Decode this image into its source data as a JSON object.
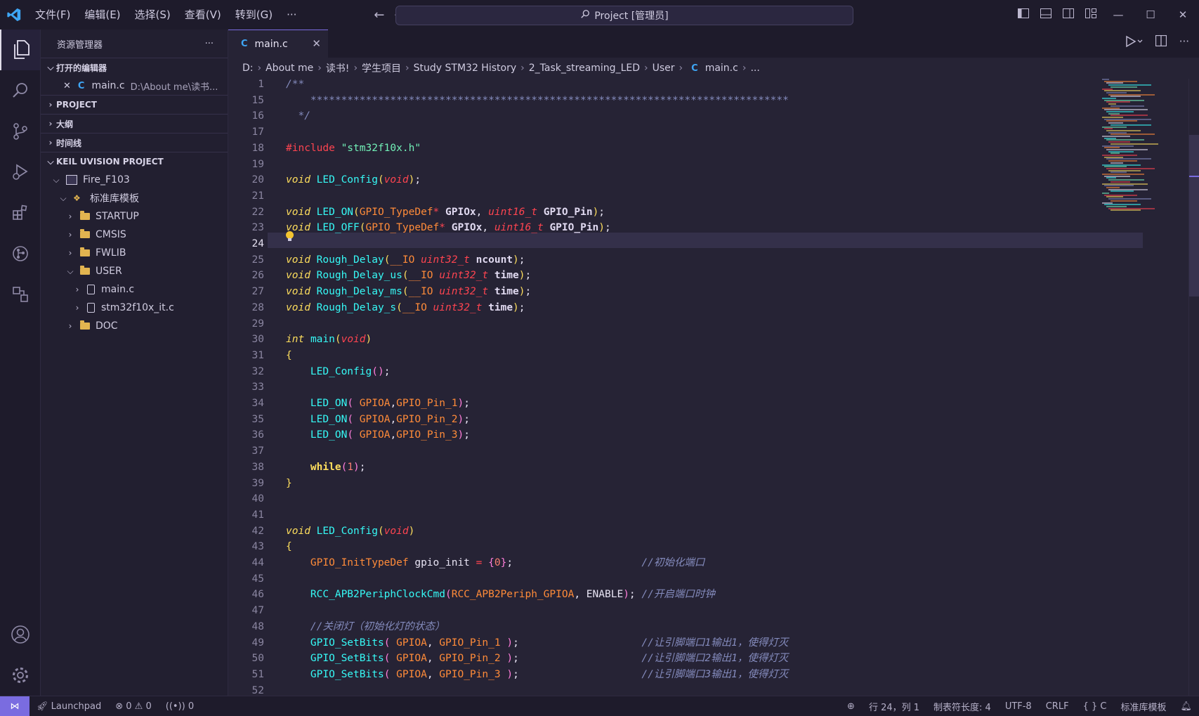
{
  "titlebar": {
    "menus": [
      "文件(F)",
      "编辑(E)",
      "选择(S)",
      "查看(V)",
      "转到(G)",
      "···"
    ],
    "search": "Project [管理员]"
  },
  "sidebar": {
    "title": "资源管理器",
    "more": "···",
    "open_editors_label": "打开的编辑器",
    "open_file_name": "main.c",
    "open_file_path": "D:\\About me\\读书...",
    "sections": [
      "PROJECT",
      "大纲",
      "时间线"
    ],
    "keil_label": "KEIL UVISION PROJECT",
    "tree": {
      "root": "Fire_F103",
      "group": "标准库模板",
      "startup": "STARTUP",
      "cmsis": "CMSIS",
      "fwlib": "FWLIB",
      "user": "USER",
      "main": "main.c",
      "it": "stm32f10x_it.c",
      "doc": "DOC"
    }
  },
  "tab": {
    "icon": "C",
    "label": "main.c"
  },
  "breadcrumb": [
    "D:",
    "About me",
    "读书!",
    "学生项目",
    "Study STM32 History",
    "2_Task_streaming_LED",
    "User",
    "main.c",
    "..."
  ],
  "editor": {
    "current_line": 24,
    "lines": [
      {
        "n": 1,
        "html": "<span class='cm'>/**</span>"
      },
      {
        "n": 15,
        "html": "<span class='cm'>    ******************************************************************************</span>"
      },
      {
        "n": 16,
        "html": "<span class='cm'>  */</span>"
      },
      {
        "n": 17,
        "html": ""
      },
      {
        "n": 18,
        "html": "<span class='pp'>#include</span> <span class='str'>\"stm32f10x.h\"</span>"
      },
      {
        "n": 19,
        "html": ""
      },
      {
        "n": 20,
        "html": "<span class='kw'>void</span> <span class='fn'>LED_Config</span><span class='br2'>(</span><span class='ty'>void</span><span class='br2'>)</span><span class='pu'>;</span>"
      },
      {
        "n": 21,
        "html": ""
      },
      {
        "n": 22,
        "html": "<span class='kw'>void</span> <span class='fn'>LED_ON</span><span class='br2'>(</span><span class='tyu'>GPIO_TypeDef</span><span class='op'>*</span> <span class='pb'>GPIOx</span><span class='pu'>,</span> <span class='ty'>uint16_t</span> <span class='pb'>GPIO_Pin</span><span class='br2'>)</span><span class='pu'>;</span>"
      },
      {
        "n": 23,
        "html": "<span class='kw'>void</span> <span class='fn'>LED_OFF</span><span class='br2'>(</span><span class='tyu'>GPIO_TypeDef</span><span class='op'>*</span> <span class='pb'>GPIOx</span><span class='pu'>,</span> <span class='ty'>uint16_t</span> <span class='pb'>GPIO_Pin</span><span class='br2'>)</span><span class='pu'>;</span>"
      },
      {
        "n": 24,
        "html": ""
      },
      {
        "n": 25,
        "html": "<span class='kw'>void</span> <span class='fn'>Rough_Delay</span><span class='br2'>(</span><span class='mac'>__IO</span> <span class='ty'>uint32_t</span> <span class='pb'>ncount</span><span class='br2'>)</span><span class='pu'>;</span>"
      },
      {
        "n": 26,
        "html": "<span class='kw'>void</span> <span class='fn'>Rough_Delay_us</span><span class='br2'>(</span><span class='mac'>__IO</span> <span class='ty'>uint32_t</span> <span class='pb'>time</span><span class='br2'>)</span><span class='pu'>;</span>"
      },
      {
        "n": 27,
        "html": "<span class='kw'>void</span> <span class='fn'>Rough_Delay_ms</span><span class='br2'>(</span><span class='mac'>__IO</span> <span class='ty'>uint32_t</span> <span class='pb'>time</span><span class='br2'>)</span><span class='pu'>;</span>"
      },
      {
        "n": 28,
        "html": "<span class='kw'>void</span> <span class='fn'>Rough_Delay_s</span><span class='br2'>(</span><span class='mac'>__IO</span> <span class='ty'>uint32_t</span> <span class='pb'>time</span><span class='br2'>)</span><span class='pu'>;</span>"
      },
      {
        "n": 29,
        "html": ""
      },
      {
        "n": 30,
        "html": "<span class='kw'>int</span> <span class='fn'>main</span><span class='br2'>(</span><span class='ty'>void</span><span class='br2'>)</span>"
      },
      {
        "n": 31,
        "html": "<span class='br2'>{</span>"
      },
      {
        "n": 32,
        "html": "    <span class='fn'>LED_Config</span><span class='br'>()</span><span class='pu'>;</span>"
      },
      {
        "n": 33,
        "html": ""
      },
      {
        "n": 34,
        "html": "    <span class='fn'>LED_ON</span><span class='br'>(</span> <span class='tyu'>GPIOA</span><span class='pu'>,</span><span class='tyu'>GPIO_Pin_1</span><span class='br'>)</span><span class='pu'>;</span>"
      },
      {
        "n": 35,
        "html": "    <span class='fn'>LED_ON</span><span class='br'>(</span> <span class='tyu'>GPIOA</span><span class='pu'>,</span><span class='tyu'>GPIO_Pin_2</span><span class='br'>)</span><span class='pu'>;</span>"
      },
      {
        "n": 36,
        "html": "    <span class='fn'>LED_ON</span><span class='br'>(</span> <span class='tyu'>GPIOA</span><span class='pu'>,</span><span class='tyu'>GPIO_Pin_3</span><span class='br'>)</span><span class='pu'>;</span>"
      },
      {
        "n": 37,
        "html": ""
      },
      {
        "n": 38,
        "html": "    <span class='kwp' style='font-weight:bold;color:#fede5d'>while</span><span class='br'>(</span><span class='num'>1</span><span class='br'>)</span><span class='pu'>;</span>"
      },
      {
        "n": 39,
        "html": "<span class='br2'>}</span>"
      },
      {
        "n": 40,
        "html": ""
      },
      {
        "n": 41,
        "html": ""
      },
      {
        "n": 42,
        "html": "<span class='kw'>void</span> <span class='fn'>LED_Config</span><span class='br2'>(</span><span class='ty'>void</span><span class='br2'>)</span>"
      },
      {
        "n": 43,
        "html": "<span class='br2'>{</span>"
      },
      {
        "n": 44,
        "html": "    <span class='tyu'>GPIO_InitTypeDef</span> <span class='pl'>gpio_init</span> <span class='op'>=</span> <span class='br'>{</span><span class='num'>0</span><span class='br'>}</span><span class='pu'>;</span>                     <span class='cm'>//初始化端口</span>"
      },
      {
        "n": 45,
        "html": ""
      },
      {
        "n": 46,
        "html": "    <span class='fn'>RCC_APB2PeriphClockCmd</span><span class='br'>(</span><span class='tyu'>RCC_APB2Periph_GPIOA</span><span class='pu'>,</span> <span class='pl'>ENABLE</span><span class='br'>)</span><span class='pu'>;</span> <span class='cm'>//开启端口时钟</span>"
      },
      {
        "n": 47,
        "html": ""
      },
      {
        "n": 48,
        "html": "    <span class='cm'>//关闭灯（初始化灯的状态）</span>"
      },
      {
        "n": 49,
        "html": "    <span class='fn'>GPIO_SetBits</span><span class='br'>(</span> <span class='tyu'>GPIOA</span><span class='pu'>,</span> <span class='tyu'>GPIO_Pin_1</span> <span class='br'>)</span><span class='pu'>;</span>                    <span class='cm'>//让引脚端口1输出1，使得灯灭</span>"
      },
      {
        "n": 50,
        "html": "    <span class='fn'>GPIO_SetBits</span><span class='br'>(</span> <span class='tyu'>GPIOA</span><span class='pu'>,</span> <span class='tyu'>GPIO_Pin_2</span> <span class='br'>)</span><span class='pu'>;</span>                    <span class='cm'>//让引脚端口2输出1，使得灯灭</span>"
      },
      {
        "n": 51,
        "html": "    <span class='fn'>GPIO_SetBits</span><span class='br'>(</span> <span class='tyu'>GPIOA</span><span class='pu'>,</span> <span class='tyu'>GPIO_Pin_3</span> <span class='br'>)</span><span class='pu'>;</span>                    <span class='cm'>//让引脚端口3输出1，使得灯灭</span>"
      },
      {
        "n": 52,
        "html": ""
      }
    ]
  },
  "status": {
    "launchpad": "Launchpad",
    "errors": "0",
    "warnings": "0",
    "ports": "0",
    "position": "行 24，列 1",
    "tab_size": "制表符长度: 4",
    "encoding": "UTF-8",
    "eol": "CRLF",
    "language": "C",
    "target": "标准库模板"
  },
  "colors": {
    "accent": "#7a6ce0",
    "background": "#262335",
    "chrome": "#1e1b2b"
  }
}
